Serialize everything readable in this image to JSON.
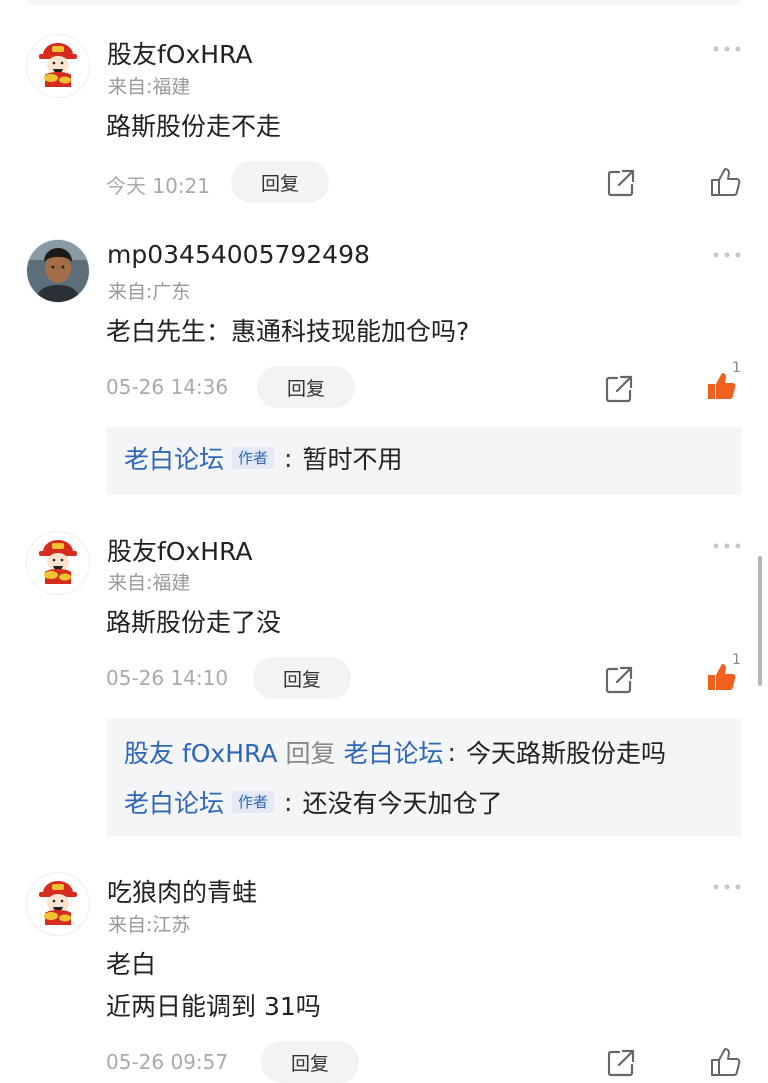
{
  "comments": [
    {
      "username": "股友fOxHRA",
      "location": "来自:福建",
      "lines": [
        "路斯股份走不走"
      ],
      "time": "今天 10:21",
      "reply_label": "回复",
      "like_active": false,
      "like_count": ""
    },
    {
      "username": "mp03454005792498",
      "location": "来自:广东",
      "lines": [
        "老白先生：惠通科技现能加仓吗?"
      ],
      "time": "05-26 14:36",
      "reply_label": "回复",
      "like_active": true,
      "like_count": "1",
      "replies": [
        {
          "from": "老白论坛",
          "tag": "作者",
          "text": "暂时不用"
        }
      ]
    },
    {
      "username": "股友fOxHRA",
      "location": "来自:福建",
      "lines": [
        "路斯股份走了没"
      ],
      "time": "05-26 14:10",
      "reply_label": "回复",
      "like_active": true,
      "like_count": "1",
      "replies": [
        {
          "from": "股友 fOxHRA",
          "reply_word": "回复",
          "to": "老白论坛",
          "text": "今天路斯股份走吗"
        },
        {
          "from": "老白论坛",
          "tag": "作者",
          "text": "还没有今天加仓了"
        }
      ]
    },
    {
      "username": "吃狼肉的青蛙",
      "location": "来自:江苏",
      "lines": [
        "老白",
        "近两日能调到 31吗"
      ],
      "time": "05-26 09:57",
      "reply_label": "回复",
      "like_active": false,
      "like_count": ""
    }
  ],
  "colors": {
    "accent_blue": "#2f66b8",
    "like_orange": "#f0601e",
    "meta_gray": "#999999"
  },
  "icons": [
    "more-icon",
    "share-icon",
    "thumbs-up-icon",
    "avatar-caishen",
    "avatar-photo"
  ]
}
